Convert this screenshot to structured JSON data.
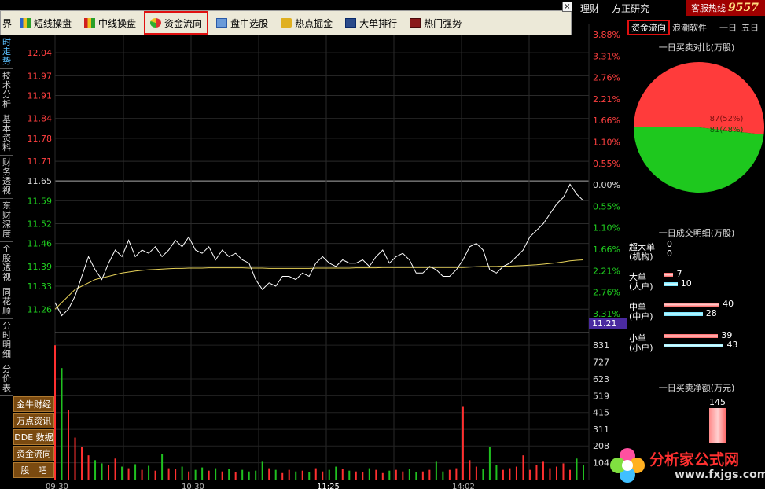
{
  "top_bar": {
    "left_partial": "界",
    "items": [
      "理财",
      "方正研究"
    ],
    "hotline_label": "客服热线",
    "hotline_number": "9557"
  },
  "toolbar": {
    "items": [
      {
        "label": "短线操盘",
        "icon": "bar-chart-icon"
      },
      {
        "label": "中线操盘",
        "icon": "bar-chart-icon"
      },
      {
        "label": "资金流向",
        "icon": "pie-icon",
        "active": true
      },
      {
        "label": "盘中选股",
        "icon": "chart-window-icon"
      },
      {
        "label": "热点掘金",
        "icon": "gold-icon"
      },
      {
        "label": "大单排行",
        "icon": "ranking-icon"
      },
      {
        "label": "热门强势",
        "icon": "trend-icon"
      }
    ],
    "close_label": "×"
  },
  "left_tabs": [
    "时走势",
    "技术分析",
    "基本资料",
    "财务透视",
    "东财深度",
    "个股透视",
    "同花顺",
    "分时明细",
    "分价表"
  ],
  "left_buttons": [
    "金牛财经",
    "万点资讯",
    "DDE 数据",
    "资金流向",
    "股　吧"
  ],
  "chart_data": {
    "type": "line",
    "price_ticks": [
      "12.04",
      "11.97",
      "11.91",
      "11.84",
      "11.78",
      "11.71",
      "11.65",
      "11.59",
      "11.52",
      "11.46",
      "11.39",
      "11.33",
      "11.26"
    ],
    "pct_ticks": [
      "3.88%",
      "3.31%",
      "2.76%",
      "2.21%",
      "1.66%",
      "1.10%",
      "0.55%",
      "0.00%",
      "0.55%",
      "1.10%",
      "1.66%",
      "2.21%",
      "2.76%",
      "3.31%"
    ],
    "current_price": "11.21",
    "volume_ticks": [
      "831",
      "727",
      "623",
      "519",
      "415",
      "311",
      "208",
      "104"
    ],
    "time_labels": [
      "09:30",
      "10:30",
      "11:25",
      "14:02"
    ],
    "price": [
      11.28,
      11.24,
      11.26,
      11.3,
      11.36,
      11.42,
      11.38,
      11.35,
      11.4,
      11.44,
      11.42,
      11.47,
      11.42,
      11.44,
      11.43,
      11.45,
      11.42,
      11.44,
      11.47,
      11.45,
      11.48,
      11.44,
      11.43,
      11.45,
      11.41,
      11.44,
      11.42,
      11.43,
      11.41,
      11.4,
      11.35,
      11.32,
      11.34,
      11.33,
      11.36,
      11.36,
      11.35,
      11.37,
      11.36,
      11.4,
      11.42,
      11.4,
      11.39,
      11.41,
      11.4,
      11.4,
      11.41,
      11.39,
      11.42,
      11.44,
      11.4,
      11.42,
      11.43,
      11.41,
      11.37,
      11.37,
      11.39,
      11.38,
      11.36,
      11.36,
      11.38,
      11.41,
      11.45,
      11.46,
      11.44,
      11.38,
      11.37,
      11.39,
      11.4,
      11.42,
      11.44,
      11.48,
      11.5,
      11.52,
      11.55,
      11.58,
      11.6,
      11.64,
      11.61,
      11.59
    ],
    "avg_price": [
      11.26,
      11.28,
      11.3,
      11.32,
      11.33,
      11.34,
      11.35,
      11.355,
      11.36,
      11.365,
      11.37,
      11.373,
      11.376,
      11.378,
      11.38,
      11.381,
      11.382,
      11.383,
      11.384,
      11.384,
      11.385,
      11.385,
      11.385,
      11.386,
      11.386,
      11.386,
      11.386,
      11.386,
      11.386,
      11.385,
      11.385,
      11.385,
      11.384,
      11.384,
      11.384,
      11.384,
      11.384,
      11.384,
      11.384,
      11.385,
      11.385,
      11.385,
      11.385,
      11.385,
      11.385,
      11.386,
      11.386,
      11.386,
      11.386,
      11.387,
      11.387,
      11.387,
      11.387,
      11.387,
      11.387,
      11.387,
      11.387,
      11.387,
      11.387,
      11.387,
      11.387,
      11.387,
      11.388,
      11.389,
      11.39,
      11.39,
      11.39,
      11.391,
      11.391,
      11.392,
      11.393,
      11.394,
      11.395,
      11.397,
      11.399,
      11.401,
      11.404,
      11.407,
      11.409,
      11.41
    ],
    "volume": [
      831,
      690,
      430,
      260,
      200,
      150,
      120,
      100,
      90,
      130,
      80,
      70,
      95,
      60,
      85,
      55,
      160,
      70,
      65,
      80,
      50,
      60,
      75,
      55,
      70,
      50,
      65,
      45,
      60,
      50,
      55,
      110,
      70,
      60,
      40,
      60,
      50,
      55,
      45,
      70,
      50,
      60,
      80,
      65,
      55,
      50,
      45,
      70,
      60,
      40,
      55,
      60,
      50,
      65,
      45,
      50,
      60,
      110,
      50,
      60,
      70,
      450,
      120,
      80,
      65,
      200,
      90,
      60,
      70,
      80,
      150,
      60,
      90,
      110,
      70,
      80,
      100,
      60,
      130,
      90
    ]
  },
  "right_panel": {
    "tabs": [
      "资金流向",
      "浪潮软件"
    ],
    "days": [
      "一日",
      "五日"
    ],
    "pie_title": "一日买卖对比(万股)",
    "pie": [
      {
        "label": "87(52%)",
        "value": 87,
        "color": "#ff3b3b"
      },
      {
        "label": "81(48%)",
        "value": 81,
        "color": "#1ec81e"
      }
    ],
    "detail_title": "一日成交明细(万股)",
    "rows": [
      {
        "label1": "超大单",
        "label2": "(机构)",
        "buy": 0,
        "sell": 0
      },
      {
        "label1": "大单",
        "label2": "(大户)",
        "buy": 7,
        "sell": 10
      },
      {
        "label1": "中单",
        "label2": "(中户)",
        "buy": 40,
        "sell": 28
      },
      {
        "label1": "小单",
        "label2": "(小户)",
        "buy": 39,
        "sell": 43
      }
    ],
    "net_title": "一日买卖净额(万元)",
    "net_value": 145
  },
  "logo": {
    "text": "分析家公式网",
    "url": "www.fxjgs.com"
  }
}
